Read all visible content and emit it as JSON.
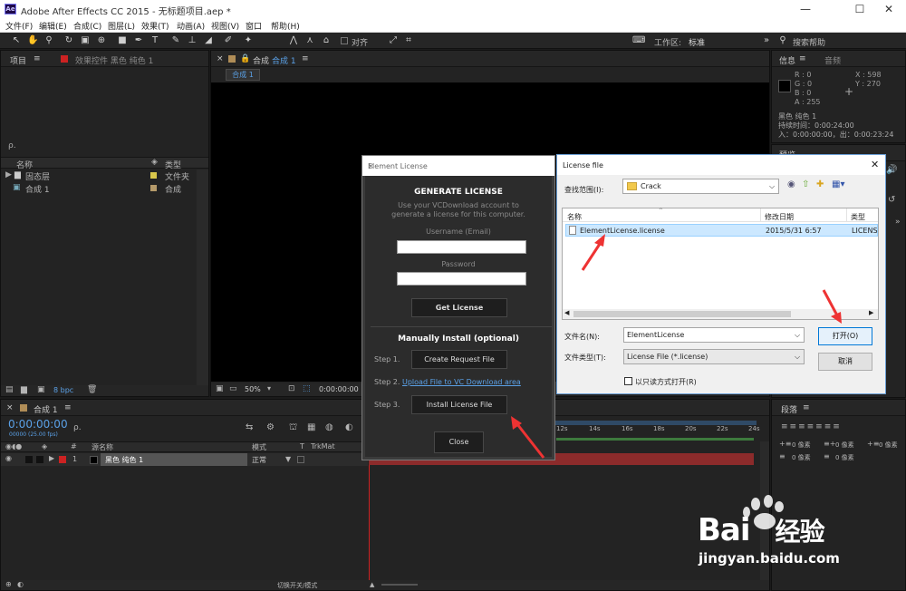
{
  "window": {
    "app_icon_text": "Ae",
    "title": "Adobe After Effects CC 2015 - 无标题项目.aep *",
    "minimize": "—",
    "maximize": "☐",
    "close": "✕"
  },
  "menu": [
    "文件(F)",
    "编辑(E)",
    "合成(C)",
    "图层(L)",
    "效果(T)",
    "动画(A)",
    "视图(V)",
    "窗口",
    "帮助(H)"
  ],
  "toolbar": {
    "align_label": "对齐",
    "workspace_label": "工作区:",
    "workspace_value": "标准",
    "search_help": "搜索帮助"
  },
  "project_panel": {
    "tab_project": "项目",
    "tab_effects": "效果控件 黑色 纯色 1",
    "search_placeholder": "ρ.",
    "col_name": "名称",
    "col_type": "类型",
    "rows": [
      {
        "name": "固态层",
        "type": "文件夹"
      },
      {
        "name": "合成 1",
        "type": "合成"
      }
    ],
    "bpc": "8 bpc"
  },
  "viewer": {
    "tab_label": "合成",
    "tab_name": "合成 1",
    "subtab": "合成 1",
    "zoom": "50%",
    "timecode": "0:00:00:00"
  },
  "info_panel": {
    "tab_info": "信息",
    "tab_audio": "音频",
    "r": "R : 0",
    "g": "G : 0",
    "b": "B : 0",
    "a": "A : 255",
    "x": "X : 598",
    "y": "Y : 270",
    "layer_name": "黑色 纯色 1",
    "duration": "持续时间：0:00:24:00",
    "in_out": "入：0:00:00:00，出：0:00:23:24",
    "preview_tab": "预览"
  },
  "timeline": {
    "tab_name": "合成 1",
    "timecode": "0:00:00:00",
    "fps": "00000 (25.00 fps)",
    "search_placeholder": "ρ.",
    "col_source": "源名称",
    "col_mode": "模式",
    "col_t": "T",
    "col_trkmat": "TrkMat",
    "layer_num": "1",
    "layer_name": "黑色 纯色 1",
    "layer_mode": "正常",
    "ruler": [
      "12s",
      "14s",
      "16s",
      "18s",
      "20s",
      "22s",
      "24s"
    ],
    "bottom_label": "切换开关/模式"
  },
  "paragraph_panel": {
    "tab": "段落",
    "px": "0 像素"
  },
  "element_dialog": {
    "title": "Element License",
    "heading": "GENERATE LICENSE",
    "subtext_1": "Use your VCDownload account to",
    "subtext_2": "generate a license for this computer.",
    "username_label": "Username (Email)",
    "password_label": "Password",
    "get_license": "Get License",
    "manual_heading": "Manually Install (optional)",
    "step1": "Step 1.",
    "step2": "Step 2.",
    "step3": "Step 3.",
    "create_request": "Create Request File",
    "upload_link": "Upload File to VC Download area",
    "install_license": "Install License File",
    "close_btn": "Close"
  },
  "file_dialog": {
    "title": "License file",
    "lookin_label": "查找范围(I):",
    "lookin_value": "Crack",
    "col_name": "名称",
    "col_date": "修改日期",
    "col_type": "类型",
    "file_name": "ElementLicense.license",
    "file_date": "2015/5/31 6:57",
    "file_type": "LICENS",
    "filename_label": "文件名(N):",
    "filename_value": "ElementLicense",
    "filetype_label": "文件类型(T):",
    "filetype_value": "License File (*.license)",
    "readonly_label": "以只读方式打开(R)",
    "open_btn": "打开(O)",
    "cancel_btn": "取消"
  },
  "watermark": {
    "brand_1": "Bai",
    "brand_2": "经验",
    "url": "jingyan.baidu.com"
  }
}
